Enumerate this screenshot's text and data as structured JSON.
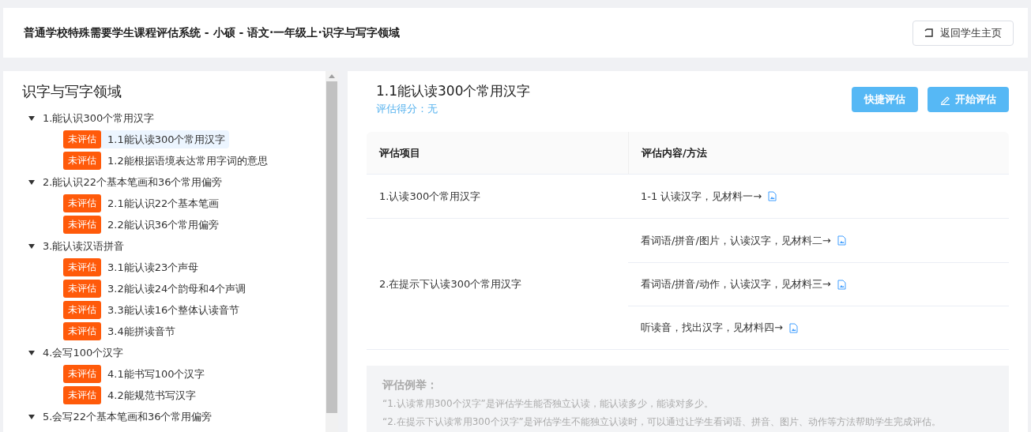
{
  "header": {
    "title": "普通学校特殊需要学生课程评估系统 - 小硕 - 语文·一年级上·识字与写字领域",
    "back_button": "返回学生主页"
  },
  "sidebar": {
    "title": "识字与写字领域",
    "tree": [
      {
        "label": "1.能认识300个常用汉字",
        "expanded": true,
        "children": [
          {
            "label": "1.1能认读300个常用汉字",
            "status": "未评估",
            "selected": true
          },
          {
            "label": "1.2能根据语境表达常用字词的意思",
            "status": "未评估",
            "selected": false
          }
        ]
      },
      {
        "label": "2.能认识22个基本笔画和36个常用偏旁",
        "expanded": true,
        "children": [
          {
            "label": "2.1能认识22个基本笔画",
            "status": "未评估",
            "selected": false
          },
          {
            "label": "2.2能认识36个常用偏旁",
            "status": "未评估",
            "selected": false
          }
        ]
      },
      {
        "label": "3.能认读汉语拼音",
        "expanded": true,
        "children": [
          {
            "label": "3.1能认读23个声母",
            "status": "未评估",
            "selected": false
          },
          {
            "label": "3.2能认读24个韵母和4个声调",
            "status": "未评估",
            "selected": false
          },
          {
            "label": "3.3能认读16个整体认读音节",
            "status": "未评估",
            "selected": false
          },
          {
            "label": "3.4能拼读音节",
            "status": "未评估",
            "selected": false
          }
        ]
      },
      {
        "label": "4.会写100个汉字",
        "expanded": true,
        "children": [
          {
            "label": "4.1能书写100个汉字",
            "status": "未评估",
            "selected": false
          },
          {
            "label": "4.2能规范书写汉字",
            "status": "未评估",
            "selected": false
          }
        ]
      },
      {
        "label": "5.会写22个基本笔画和36个常用偏旁",
        "expanded": true
      }
    ]
  },
  "detail": {
    "title": "1.1能认读300个常用汉字",
    "score": "评估得分：无",
    "buttons": [
      {
        "label": "快捷评估",
        "kind": "plain"
      },
      {
        "label": "开始评估",
        "kind": "edit"
      }
    ],
    "table": {
      "columns": [
        "评估项目",
        "评估内容/方法"
      ],
      "rows": [
        {
          "item": "1.认读300个常用汉字",
          "methods": [
            "1-1 认读汉字，见材料一→"
          ]
        },
        {
          "item": "2.在提示下认读300个常用汉字",
          "methods": [
            "看词语/拼音/图片，认读汉字，见材料二→",
            "看词语/拼音/动作，认读汉字，见材料三→",
            "听读音，找出汉字，见材料四→"
          ]
        }
      ]
    },
    "examples": {
      "title": "评估例举：",
      "lines": [
        "“1.认读常用300个汉字”是评估学生能否独立认读，能认读多少，能读对多少。",
        "“2.在提示下认读常用300个汉字”是评估学生不能独立认读时，可以通过让学生看词语、拼音、图片、动作等方法帮助学生完成评估。"
      ]
    }
  }
}
